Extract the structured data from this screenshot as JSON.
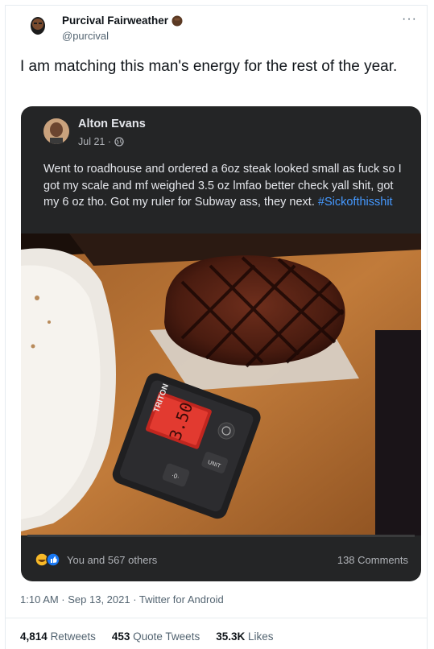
{
  "tweet": {
    "author_name": "Purcival Fairweather",
    "author_handle": "@purcival",
    "more_label": "···",
    "text": "I am matching this man's energy for the rest of the year.",
    "timestamp": "1:10 AM · Sep 13, 2021 · Twitter for Android",
    "retweets_count": "4,814",
    "retweets_label": "Retweets",
    "quote_count": "453",
    "quote_label": "Quote Tweets",
    "likes_count": "35.3K",
    "likes_label": "Likes"
  },
  "embed": {
    "name": "Alton Evans",
    "date": "Jul 21 ·",
    "text": "Went to roadhouse and ordered a 6oz steak looked small as fuck so I got my scale and mf weighed 3.5 oz lmfao better check yall shit, got my 6 oz tho. Got my ruler for Subway ass, they next.",
    "hashtag": "#Sickofthisshit",
    "reactions_label": "You and 567 others",
    "comments_label": "138 Comments",
    "scale_brand": "TRITON",
    "scale_reading": "3.50",
    "scale_unit_label": "UNIT",
    "scale_zero_label": "·0·"
  },
  "colors": {
    "embed_bg": "#242526",
    "link": "#4599ff",
    "text_dark": "#0f1419",
    "text_muted": "#536471"
  }
}
